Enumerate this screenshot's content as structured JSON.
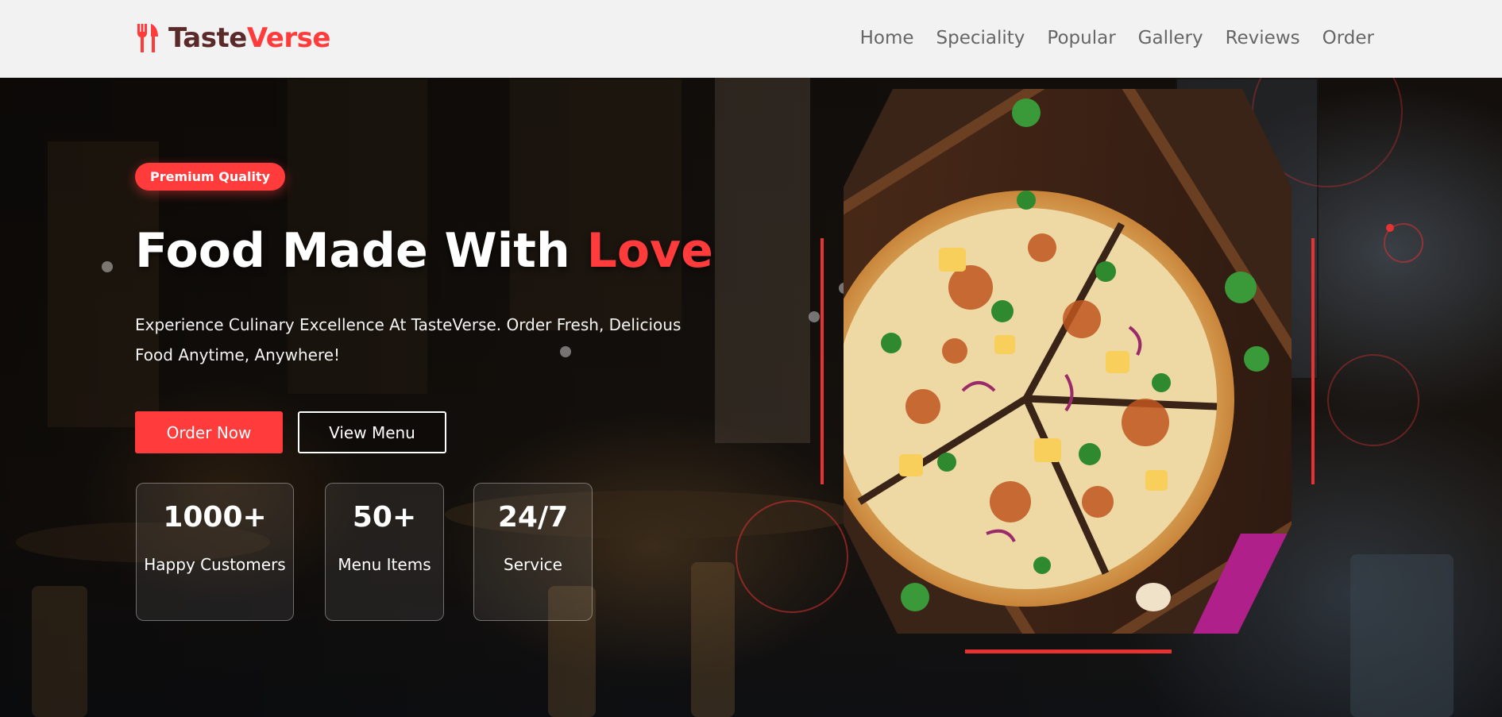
{
  "header": {
    "brand_part1": "Taste",
    "brand_part2": "Verse",
    "nav": [
      "Home",
      "Speciality",
      "Popular",
      "Gallery",
      "Reviews",
      "Order"
    ]
  },
  "hero": {
    "badge": "Premium Quality",
    "title_main": "Food Made With ",
    "title_accent": "Love",
    "description": "Experience Culinary Excellence At TasteVerse. Order Fresh, Delicious Food Anytime, Anywhere!",
    "primary_button": "Order Now",
    "secondary_button": "View Menu",
    "stats": [
      {
        "value": "1000+",
        "label": "Happy Customers"
      },
      {
        "value": "50+",
        "label": "Menu Items"
      },
      {
        "value": "24/7",
        "label": "Service"
      }
    ]
  },
  "colors": {
    "accent": "#ff3b3b",
    "brand_dark": "#5a2a2a",
    "header_bg": "#f2f2f2",
    "nav_text": "#666666"
  },
  "icons": {
    "logo": "utensils-icon"
  }
}
